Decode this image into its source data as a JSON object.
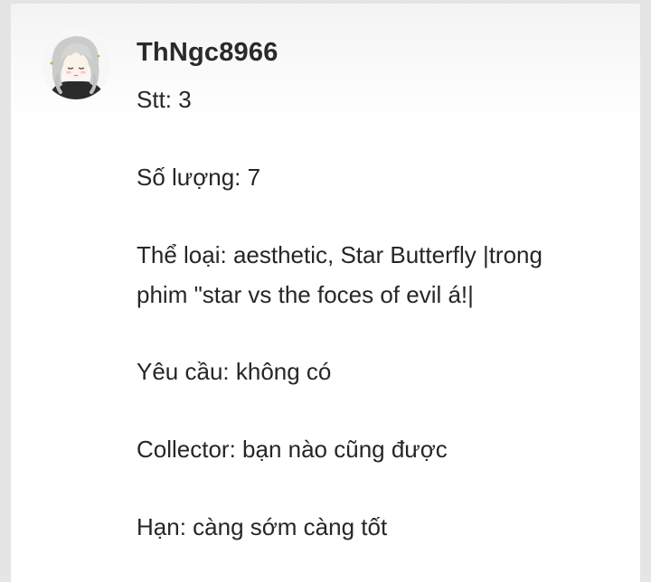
{
  "post": {
    "username": "ThNgc8966",
    "avatar_icon": "anime-girl-avatar-icon",
    "lines": {
      "stt": "Stt: 3",
      "so_luong": "Số lượng: 7",
      "the_loai_1": "Thể loại: aesthetic, Star Butterfly |trong",
      "the_loai_2": "phim \"star vs the foces of evil á!|",
      "yeu_cau": "Yêu cầu: không có",
      "collector": "Collector: bạn nào cũng được",
      "han": "Hạn: càng sớm càng tốt"
    }
  },
  "colors": {
    "text": "#262626",
    "background": "#ffffff",
    "outer": "#e4e4e4"
  }
}
